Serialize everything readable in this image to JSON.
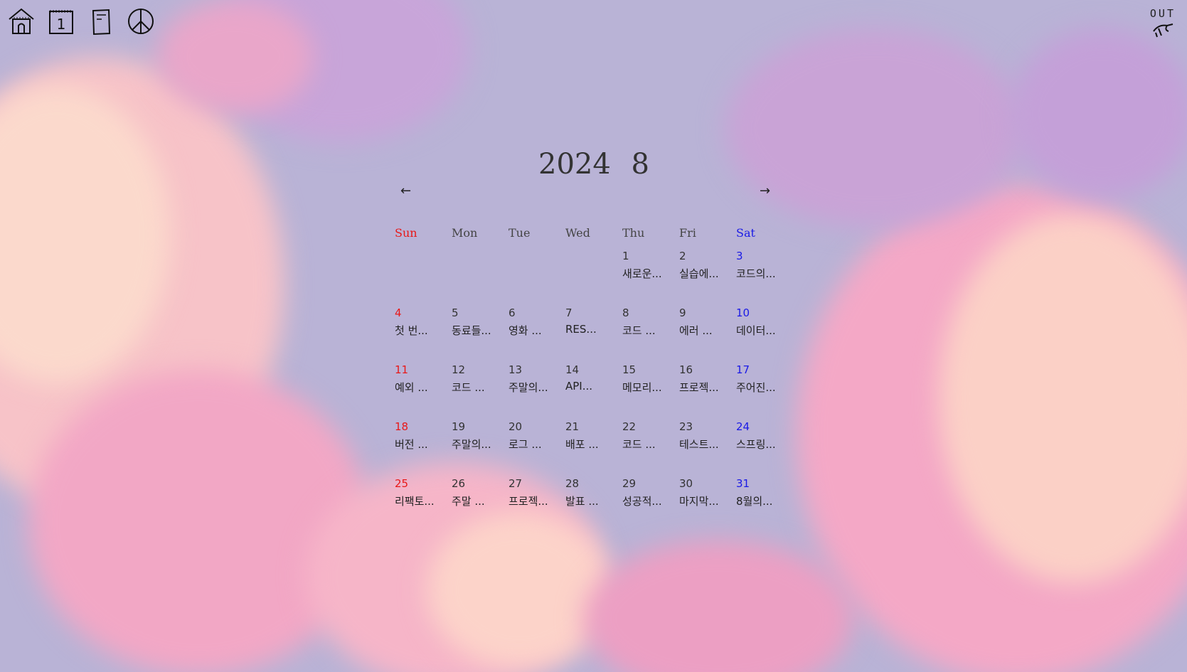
{
  "colors": {
    "sunday": "#e81818",
    "saturday": "#1a1ae6",
    "sky": "#b9b3d6",
    "cloud_pink": "#f2a9c4",
    "cloud_cream": "#fbd4c8"
  },
  "nav": [
    {
      "icon": "house-icon"
    },
    {
      "icon": "calendar-icon",
      "text": "1"
    },
    {
      "icon": "note-icon"
    },
    {
      "icon": "peace-icon"
    }
  ],
  "logout": {
    "label": "OUT",
    "icon": "leaving-hand-icon"
  },
  "calendar": {
    "year": "2024",
    "month": "8",
    "prev": "←",
    "next": "→",
    "weekdays": [
      "Sun",
      "Mon",
      "Tue",
      "Wed",
      "Thu",
      "Fri",
      "Sat"
    ],
    "weeks": [
      [
        {
          "day": "",
          "ev": ""
        },
        {
          "day": "",
          "ev": ""
        },
        {
          "day": "",
          "ev": ""
        },
        {
          "day": "",
          "ev": ""
        },
        {
          "day": "1",
          "ev": "새로운..."
        },
        {
          "day": "2",
          "ev": "실습에..."
        },
        {
          "day": "3",
          "ev": "코드의..."
        }
      ],
      [
        {
          "day": "4",
          "ev": "첫 번..."
        },
        {
          "day": "5",
          "ev": "동료들..."
        },
        {
          "day": "6",
          "ev": "영화 ..."
        },
        {
          "day": "7",
          "ev": "RES..."
        },
        {
          "day": "8",
          "ev": "코드 ..."
        },
        {
          "day": "9",
          "ev": "에러 ..."
        },
        {
          "day": "10",
          "ev": "데이터..."
        }
      ],
      [
        {
          "day": "11",
          "ev": "예외 ..."
        },
        {
          "day": "12",
          "ev": "코드 ..."
        },
        {
          "day": "13",
          "ev": "주말의..."
        },
        {
          "day": "14",
          "ev": "API..."
        },
        {
          "day": "15",
          "ev": "메모리..."
        },
        {
          "day": "16",
          "ev": "프로젝..."
        },
        {
          "day": "17",
          "ev": "주어진..."
        }
      ],
      [
        {
          "day": "18",
          "ev": "버전 ..."
        },
        {
          "day": "19",
          "ev": "주말의..."
        },
        {
          "day": "20",
          "ev": "로그 ..."
        },
        {
          "day": "21",
          "ev": "배포 ..."
        },
        {
          "day": "22",
          "ev": "코드 ..."
        },
        {
          "day": "23",
          "ev": "테스트..."
        },
        {
          "day": "24",
          "ev": "스프링..."
        }
      ],
      [
        {
          "day": "25",
          "ev": "리팩토..."
        },
        {
          "day": "26",
          "ev": "주말 ..."
        },
        {
          "day": "27",
          "ev": "프로젝..."
        },
        {
          "day": "28",
          "ev": "발표 ..."
        },
        {
          "day": "29",
          "ev": "성공적..."
        },
        {
          "day": "30",
          "ev": "마지막..."
        },
        {
          "day": "31",
          "ev": "8월의..."
        }
      ]
    ]
  }
}
